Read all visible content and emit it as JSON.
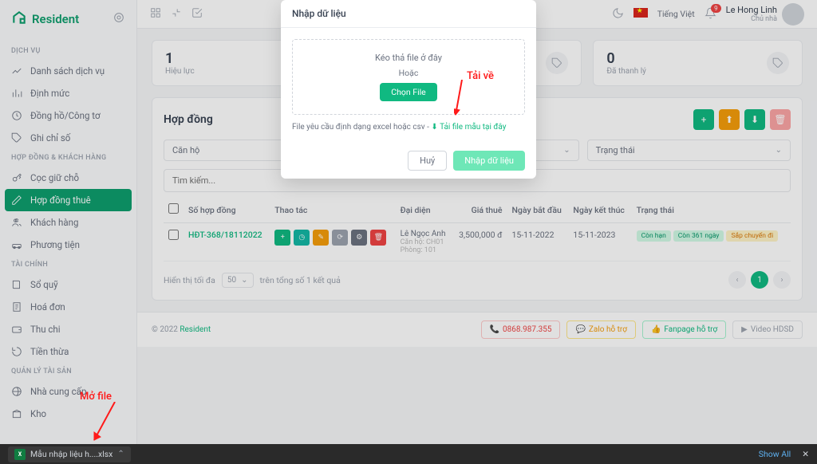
{
  "brand": "Resident",
  "sections": {
    "dichvu": {
      "label": "DỊCH VỤ",
      "items": [
        {
          "label": "Danh sách dịch vụ",
          "icon": "line"
        },
        {
          "label": "Định mức",
          "icon": "bar"
        },
        {
          "label": "Đồng hồ/Công tơ",
          "icon": "clock"
        },
        {
          "label": "Ghi chỉ số",
          "icon": "tag"
        }
      ]
    },
    "hopdong": {
      "label": "HỢP ĐỒNG & KHÁCH HÀNG",
      "items": [
        {
          "label": "Cọc giữ chỗ",
          "icon": "key"
        },
        {
          "label": "Hợp đồng thuê",
          "icon": "edit",
          "active": true
        },
        {
          "label": "Khách hàng",
          "icon": "users"
        },
        {
          "label": "Phương tiện",
          "icon": "car"
        }
      ]
    },
    "taichinh": {
      "label": "TÀI CHÍNH",
      "items": [
        {
          "label": "Sổ quỹ",
          "icon": "book"
        },
        {
          "label": "Hoá đơn",
          "icon": "invoice"
        },
        {
          "label": "Thu chi",
          "icon": "wallet"
        },
        {
          "label": "Tiền thừa",
          "icon": "refund"
        }
      ]
    },
    "taisan": {
      "label": "QUẢN LÝ TÀI SẢN",
      "items": [
        {
          "label": "Nhà cung cấp",
          "icon": "globe"
        },
        {
          "label": "Kho",
          "icon": "box"
        }
      ]
    }
  },
  "header": {
    "lang": "Tiếng Việt",
    "bell_count": "9",
    "user_name": "Le Hong Linh",
    "user_role": "Chủ nhà"
  },
  "stats": [
    {
      "num": "1",
      "label": "Hiệu lực"
    },
    {
      "num": "",
      "label": ""
    },
    {
      "num": "0",
      "label": "Đã thanh lý"
    }
  ],
  "panel": {
    "title": "Hợp đồng",
    "filters": {
      "f1": "Căn hộ",
      "f2": "",
      "f3": "Trạng thái"
    },
    "search_placeholder": "Tìm kiếm...",
    "columns": {
      "c1": "Số hợp đồng",
      "c2": "Thao tác",
      "c3": "Đại diện",
      "c4": "Giá thuê",
      "c5": "Ngày bắt đầu",
      "c6": "Ngày kết thúc",
      "c7": "Trạng thái"
    },
    "rows": [
      {
        "id": "HĐT-368/18112022",
        "rep": "Lê Ngọc Anh",
        "rep_sub1": "Căn hộ: CH01",
        "rep_sub2": "Phòng: 101",
        "price": "3,500,000 đ",
        "start": "15-11-2022",
        "end": "15-11-2023",
        "badges": [
          {
            "text": "Còn hạn",
            "cls": "b-green"
          },
          {
            "text": "Còn 361 ngày",
            "cls": "b-green"
          },
          {
            "text": "Sắp chuyển đi",
            "cls": "b-orange"
          }
        ]
      }
    ],
    "paging": {
      "pre": "Hiển thị tối đa",
      "size": "50",
      "post": "trên tổng số 1 kết quả",
      "page": "1"
    }
  },
  "footer": {
    "copyright": "© 2022",
    "brand": "Resident",
    "links": [
      {
        "text": "0868.987.355",
        "cls": "foot-red",
        "icon": "📞"
      },
      {
        "text": "Zalo hỗ trợ",
        "cls": "foot-orange",
        "icon": "💬"
      },
      {
        "text": "Fanpage hỗ trợ",
        "cls": "foot-green",
        "icon": "👍"
      },
      {
        "text": "Video HDSD",
        "cls": "",
        "icon": "▶"
      }
    ]
  },
  "modal": {
    "title": "Nhập dữ liệu",
    "drop": "Kéo thả file ở đây",
    "or": "Hoặc",
    "choose": "Chọn File",
    "note_pre": "File yêu cầu định dạng excel hoặc csv - ",
    "note_link": "Tải file mẫu tại đây",
    "note_icon": "⬇",
    "cancel": "Huỷ",
    "submit": "Nhập dữ liệu"
  },
  "annotations": {
    "a1": "Tải về",
    "a2": "Mở file"
  },
  "download": {
    "file": "Mẫu nhập liệu h....xlsx",
    "show_all": "Show All"
  }
}
